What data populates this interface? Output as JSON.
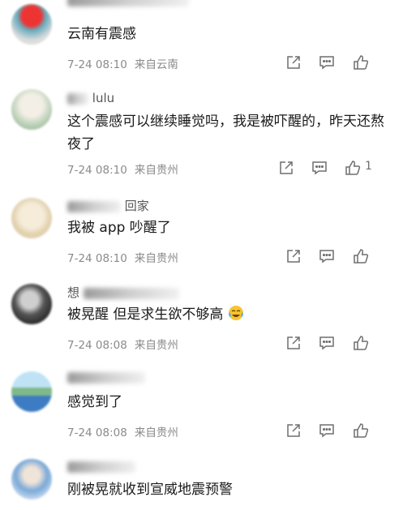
{
  "comments": [
    {
      "username_visible": "",
      "text": "云南有震感",
      "time": "7-24 08:10",
      "location": "来自云南",
      "likes": ""
    },
    {
      "username_visible": "lulu",
      "text": "这个震感可以继续睡觉吗，我是被吓醒的，昨天还熬夜了",
      "time": "7-24 08:10",
      "location": "来自贵州",
      "likes": "1"
    },
    {
      "username_visible": "回家",
      "text": "我被 app 吵醒了",
      "time": "7-24 08:10",
      "location": "来自贵州",
      "likes": ""
    },
    {
      "username_visible": "想",
      "text": "被晃醒 但是求生欲不够高",
      "time": "7-24 08:08",
      "location": "来自贵州",
      "likes": ""
    },
    {
      "username_visible": "",
      "text": "感觉到了",
      "time": "7-24 08:08",
      "location": "来自贵州",
      "likes": ""
    },
    {
      "username_visible": "",
      "text": "刚被晃就收到宣威地震预警",
      "time": "",
      "location": "",
      "likes": ""
    }
  ],
  "icons": {
    "share": "share-icon",
    "comment": "comment-icon",
    "like": "thumbs-up-icon"
  },
  "colors": {
    "text": "#1a1a1a",
    "meta": "#8a8a8a",
    "icon": "#6f6f6f"
  }
}
